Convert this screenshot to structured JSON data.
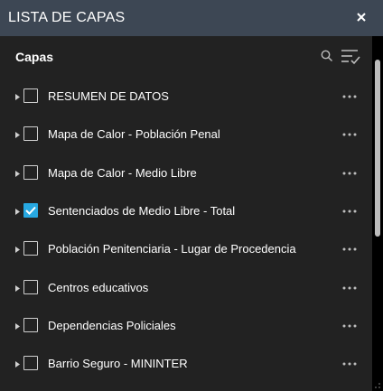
{
  "titlebar": {
    "title": "LISTA DE CAPAS",
    "close_icon": "close-icon"
  },
  "header": {
    "label": "Capas",
    "search_icon": "search-icon",
    "options_icon": "filter-list-icon"
  },
  "layers": [
    {
      "label": "RESUMEN DE DATOS",
      "checked": false
    },
    {
      "label": "Mapa de Calor - Población Penal",
      "checked": false
    },
    {
      "label": "Mapa de Calor - Medio Libre",
      "checked": false
    },
    {
      "label": "Sentenciados de Medio Libre - Total",
      "checked": true
    },
    {
      "label": "Población Penitenciaria - Lugar de Procedencia",
      "checked": false
    },
    {
      "label": "Centros educativos",
      "checked": false
    },
    {
      "label": "Dependencias Policiales",
      "checked": false
    },
    {
      "label": "Barrio Seguro - MININTER",
      "checked": false
    }
  ],
  "colors": {
    "background": "#222222",
    "titlebar": "#3d4754",
    "checkbox_checked": "#27a8e1",
    "text": "#ffffff"
  }
}
